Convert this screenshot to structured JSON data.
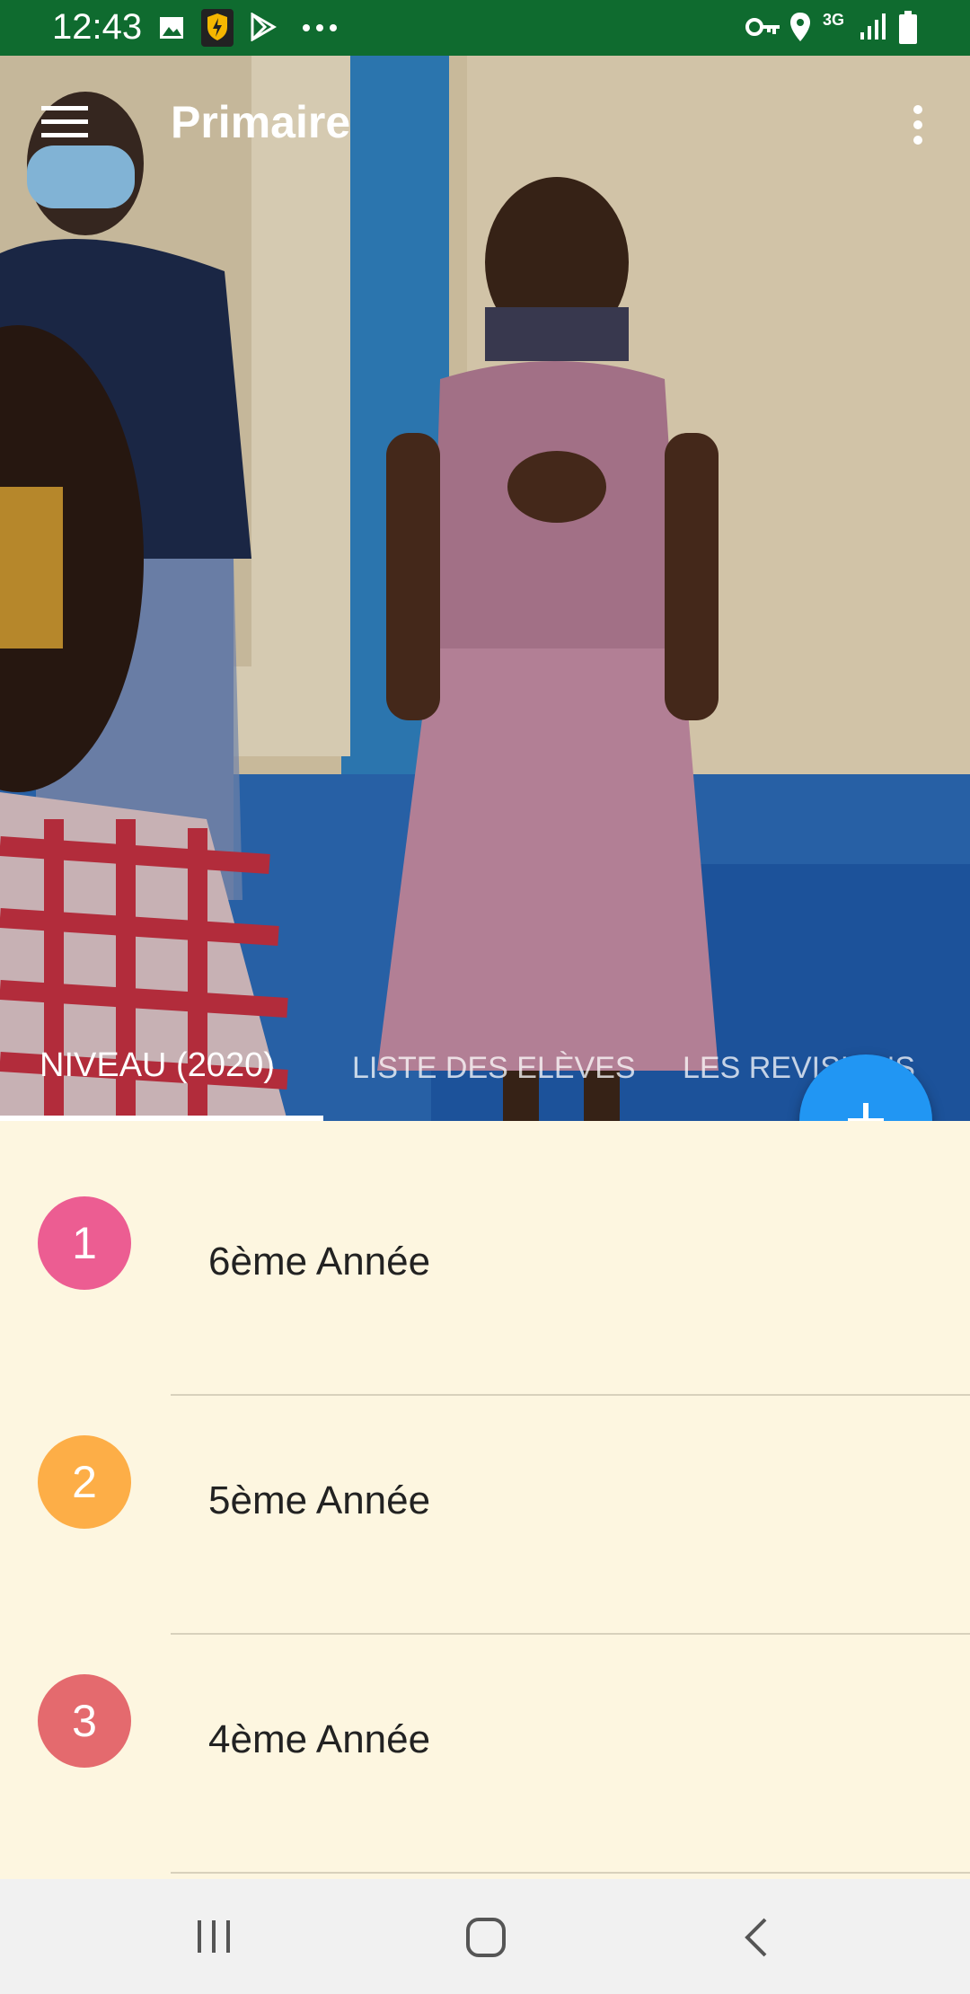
{
  "status_bar": {
    "time": "12:43",
    "network": "3G",
    "icons": [
      "image-icon",
      "vpn-shield-icon",
      "play-store-icon",
      "more-dots-icon",
      "vpn-key-icon",
      "location-icon",
      "signal-icon",
      "battery-icon"
    ]
  },
  "toolbar": {
    "title": "Primaire",
    "menu_icon": "hamburger-menu-icon",
    "overflow_icon": "overflow-menu-icon"
  },
  "tabs": [
    {
      "label": "NIVEAU (2020)",
      "selected": true
    },
    {
      "label": "LISTE DES ELÈVES",
      "selected": false
    },
    {
      "label": "LES REVISIONS",
      "selected": false
    }
  ],
  "fab": {
    "icon": "plus-icon",
    "label": "+"
  },
  "levels": [
    {
      "number": "1",
      "label": "6ème Année",
      "color": "#ec5d92"
    },
    {
      "number": "2",
      "label": "5ème Année",
      "color": "#fdae47"
    },
    {
      "number": "3",
      "label": "4ème Année",
      "color": "#e46a6e"
    }
  ],
  "colors": {
    "status_bar": "#0f6b2f",
    "fab": "#2196f3",
    "list_background": "#fdf6e0"
  },
  "nav_bar": {
    "icons": [
      "recent-apps-icon",
      "home-icon",
      "back-icon"
    ]
  }
}
